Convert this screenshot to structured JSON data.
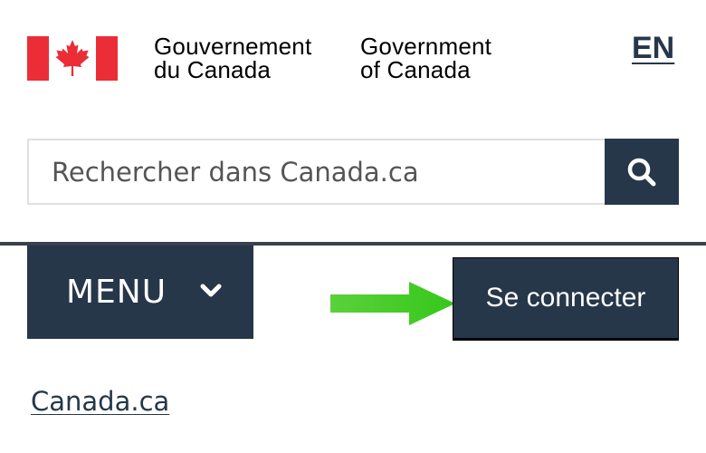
{
  "header": {
    "gov_name_fr": [
      "Gouvernement",
      "du Canada"
    ],
    "gov_name_en": [
      "Government",
      "of Canada"
    ],
    "language_toggle": "EN",
    "flag_icon": "canada-flag-icon",
    "colors": {
      "flag_red": "#eb2d37",
      "brand_navy": "#26374a"
    }
  },
  "search": {
    "placeholder": "Rechercher dans Canada.ca",
    "button_icon": "search-icon"
  },
  "nav": {
    "menu_label": "MENU",
    "menu_icon": "chevron-down-icon",
    "login_label": "Se connecter",
    "annotation_icon": "green-arrow-icon",
    "annotation_color": "#3fcf1e"
  },
  "breadcrumb": {
    "home_label": "Canada.ca"
  }
}
